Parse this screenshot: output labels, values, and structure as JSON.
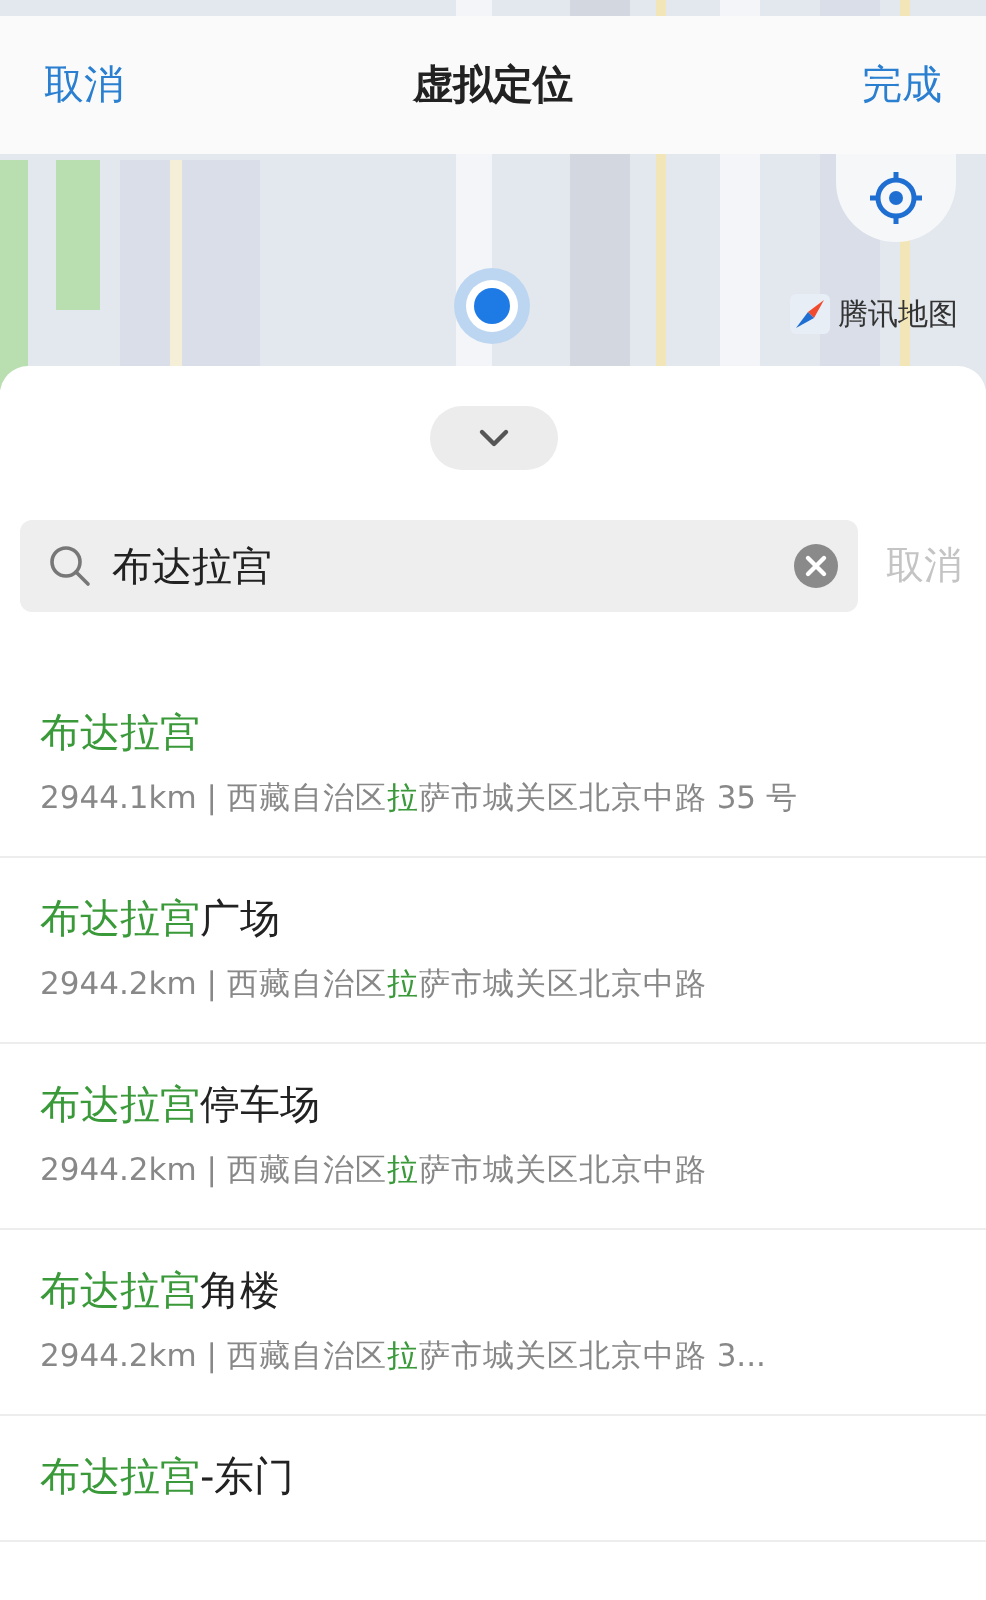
{
  "header": {
    "cancel": "取消",
    "title": "虚拟定位",
    "done": "完成"
  },
  "map": {
    "attribution": "腾讯地图"
  },
  "search": {
    "value": "布达拉宫",
    "cancel": "取消"
  },
  "results": [
    {
      "title": {
        "match": "布达拉宫"
      },
      "address": {
        "prefix": "2944.1km | 西藏自治区",
        "match": "拉",
        "suffix": "萨市城关区北京中路 35 号"
      }
    },
    {
      "title": {
        "match": "布达拉宫",
        "rest": "广场"
      },
      "address": {
        "prefix": "2944.2km | 西藏自治区",
        "match": "拉",
        "suffix": "萨市城关区北京中路"
      }
    },
    {
      "title": {
        "match": "布达拉宫",
        "rest": "停车场"
      },
      "address": {
        "prefix": "2944.2km | 西藏自治区",
        "match": "拉",
        "suffix": "萨市城关区北京中路"
      }
    },
    {
      "title": {
        "match": "布达拉宫",
        "rest": "角楼"
      },
      "address": {
        "prefix": "2944.2km | 西藏自治区",
        "match": "拉",
        "suffix": "萨市城关区北京中路 3..."
      }
    },
    {
      "title": {
        "match": "布达拉宫",
        "rest": "-东门"
      }
    }
  ]
}
